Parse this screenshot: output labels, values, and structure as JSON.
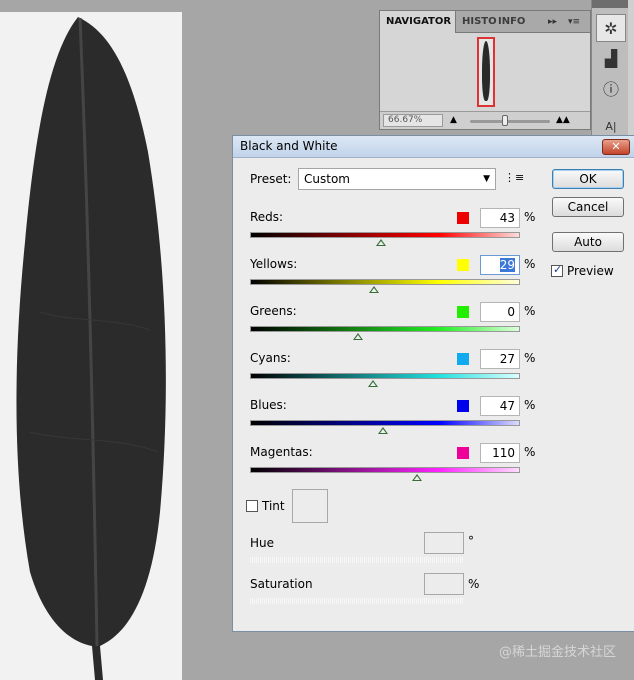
{
  "navigator": {
    "tabs": [
      "NAVIGATOR",
      "HISTO",
      "INFO"
    ],
    "zoom_value": "66.67%",
    "collapse_glyph": "▸▸",
    "menu_glyph": "▾≡"
  },
  "tool_strip": {
    "icons": [
      "navigator-icon",
      "histogram-icon",
      "info-icon",
      "type-icon"
    ]
  },
  "dialog": {
    "title": "Black and White",
    "close_glyph": "✕",
    "preset_label": "Preset:",
    "preset_value": "Custom",
    "preset_menu_glyph": "⋮≡",
    "buttons": {
      "ok": "OK",
      "cancel": "Cancel",
      "auto": "Auto"
    },
    "preview_label": "Preview",
    "preview_checked": true,
    "sliders": [
      {
        "label": "Reds:",
        "value": "43",
        "unit": "%",
        "swatch": "#ee0000",
        "position": 43,
        "min": -200,
        "max": 300,
        "gradient": [
          "#000000",
          "#ff0000",
          "#ffdcdc"
        ]
      },
      {
        "label": "Yellows:",
        "value": "29",
        "unit": "%",
        "swatch": "#ffff00",
        "position": 29,
        "min": -200,
        "max": 300,
        "gradient": [
          "#000000",
          "#ffff00",
          "#ffffdc"
        ]
      },
      {
        "label": "Greens:",
        "value": "0",
        "unit": "%",
        "swatch": "#22ee00",
        "position": 0,
        "min": -200,
        "max": 300,
        "gradient": [
          "#000000",
          "#22ee22",
          "#dcffdc"
        ]
      },
      {
        "label": "Cyans:",
        "value": "27",
        "unit": "%",
        "swatch": "#11aaee",
        "position": 27,
        "min": -200,
        "max": 300,
        "gradient": [
          "#000000",
          "#22e0e0",
          "#dcffff"
        ]
      },
      {
        "label": "Blues:",
        "value": "47",
        "unit": "%",
        "swatch": "#0000ee",
        "position": 47,
        "min": -200,
        "max": 300,
        "gradient": [
          "#000000",
          "#0000ff",
          "#dcdcff"
        ]
      },
      {
        "label": "Magentas:",
        "value": "110",
        "unit": "%",
        "swatch": "#ee0099",
        "position": 110,
        "min": -200,
        "max": 300,
        "gradient": [
          "#000000",
          "#ff22ff",
          "#ffdcff"
        ]
      }
    ],
    "tint_label": "Tint",
    "tint_checked": false,
    "hue_label": "Hue",
    "hue_unit": "°",
    "saturation_label": "Saturation",
    "saturation_unit": "%"
  },
  "watermark": "@稀土掘金技术社区"
}
